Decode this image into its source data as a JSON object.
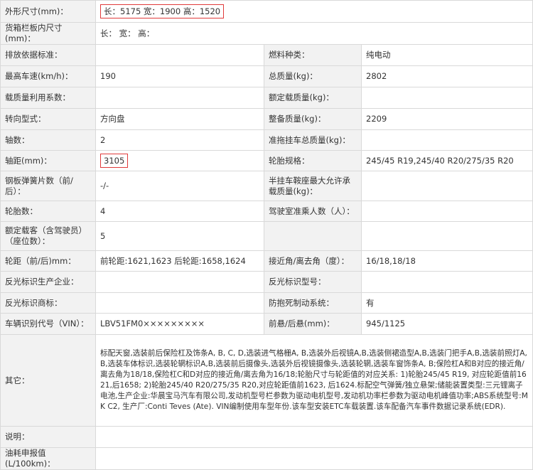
{
  "rows": {
    "r1": {
      "label": "外形尺寸(mm)：",
      "value": "长：5175 宽：1900 高：1520"
    },
    "r2": {
      "label": "货箱栏板内尺寸(mm)：",
      "value": "长： 宽： 高："
    },
    "r3": {
      "label1": "排放依据标准：",
      "value1": "",
      "label2": "燃料种类：",
      "value2": "纯电动"
    },
    "r4": {
      "label1": "最高车速(km/h)：",
      "value1": "190",
      "label2": "总质量(kg)：",
      "value2": "2802"
    },
    "r5": {
      "label1": "载质量利用系数：",
      "value1": "",
      "label2": "额定载质量(kg)：",
      "value2": ""
    },
    "r6": {
      "label1": "转向型式：",
      "value1": "方向盘",
      "label2": "整备质量(kg)：",
      "value2": "2209"
    },
    "r7": {
      "label1": "轴数：",
      "value1": "2",
      "label2": "准拖挂车总质量(kg)：",
      "value2": ""
    },
    "r8": {
      "label1": "轴距(mm)：",
      "value1": "3105",
      "label2": "轮胎规格：",
      "value2": "245/45 R19,245/40 R20/275/35 R20"
    },
    "r9": {
      "label1": "钢板弹簧片数（前/后）：",
      "value1": "-/-",
      "label2": "半挂车鞍座最大允许承载质量(kg)：",
      "value2": ""
    },
    "r10": {
      "label1": "轮胎数：",
      "value1": "4",
      "label2": "驾驶室准乘人数（人）：",
      "value2": ""
    },
    "r11": {
      "label1": "额定载客（含驾驶员）（座位数）：",
      "value1": "5",
      "label2": "",
      "value2": ""
    },
    "r12": {
      "label1": "轮距（前/后)mm：",
      "value1": "前轮距:1621,1623 后轮距:1658,1624",
      "label2": "接近角/离去角（度）：",
      "value2": "16/18,18/18"
    },
    "r13": {
      "label1": "反光标识生产企业：",
      "value1": "",
      "label2": "反光标识型号：",
      "value2": ""
    },
    "r14": {
      "label1": "反光标识商标：",
      "value1": "",
      "label2": "防抱死制动系统：",
      "value2": "有"
    },
    "r15": {
      "label1": "车辆识别代号（VIN）：",
      "value1": "LBV51FM0×××××××××",
      "label2": "前悬/后悬(mm)：",
      "value2": "945/1125"
    },
    "r16": {
      "label": "其它：",
      "value": "标配天窗,选装前后保险杠及饰条A, B, C, D,选装进气格栅A, B,选装外后视镜A,B,选装侧裙造型A,B,选装门把手A,B,选装前照灯A, B,选装车体标识,选装轮辋标识A,B,选装前后摄像头,选装外后视镜摄像头,选装轮辋,选装车窗饰条A, B;保险杠A和B对应的接近角/离去角为18/18,保险杠C和D对应的接近角/离去角为16/18;轮胎尺寸与轮距值的对应关系: 1)轮胎245/45 R19, 对应轮距值前1621,后1658; 2)轮胎245/40 R20/275/35 R20,对应轮距值前1623, 后1624.标配空气弹簧/独立悬架;储能装置类型:三元锂离子电池,生产企业:华晨宝马汽车有限公司,发动机型号栏参数为驱动电机型号,发动机功率栏参数为驱动电机峰值功率;ABS系统型号:MK C2, 生产厂:Conti Teves (Ate). VIN编制使用车型年份.该车型安装ETC车载装置.该车配备汽车事件数据记录系统(EDR)."
    },
    "r17": {
      "label": "说明：",
      "value": ""
    },
    "r18": {
      "label": "油耗申报值(L/100km)：",
      "value": ""
    }
  },
  "colors": {
    "label_bg": "#f2f2f2",
    "border": "#d9d9d9",
    "highlight": "#e03a3a"
  }
}
